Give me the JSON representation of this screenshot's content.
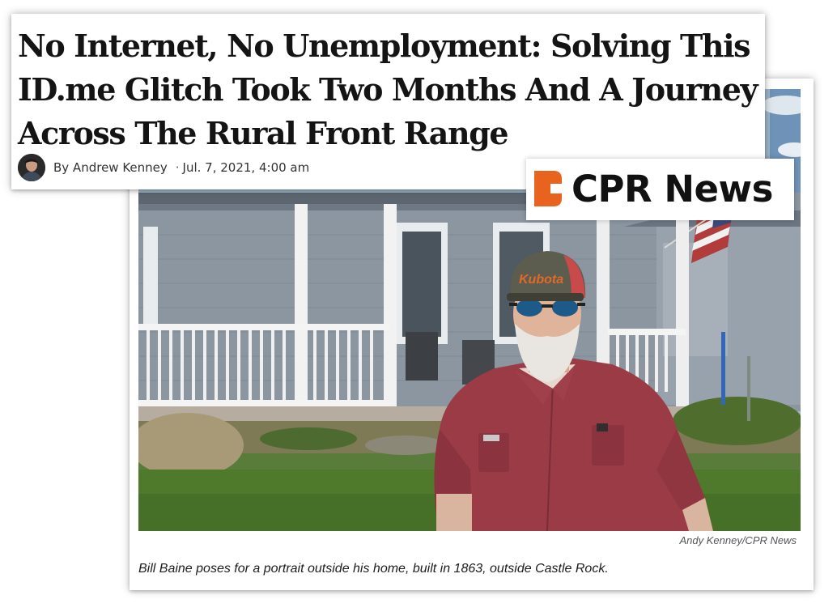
{
  "article": {
    "headline": "No Internet, No Unemployment: Solving This ID.me Glitch Took Two Months And A Journey Across The Rural Front Range",
    "byline": "By Andrew Kenney",
    "separator": "·",
    "date": "Jul. 7, 2021, 4:00 am"
  },
  "photo": {
    "credit": "Andy Kenney/CPR News",
    "caption": "Bill Baine poses for a portrait outside his home, built in 1863, outside Castle Rock.",
    "cap_text": "Kubota"
  },
  "logo": {
    "text": "CPR News",
    "icon": "cpr-logo-icon",
    "accent_color": "#e8641e"
  },
  "colors": {
    "headline": "#141414",
    "shirt": "#9a3b46",
    "siding": "#8e98a2"
  }
}
